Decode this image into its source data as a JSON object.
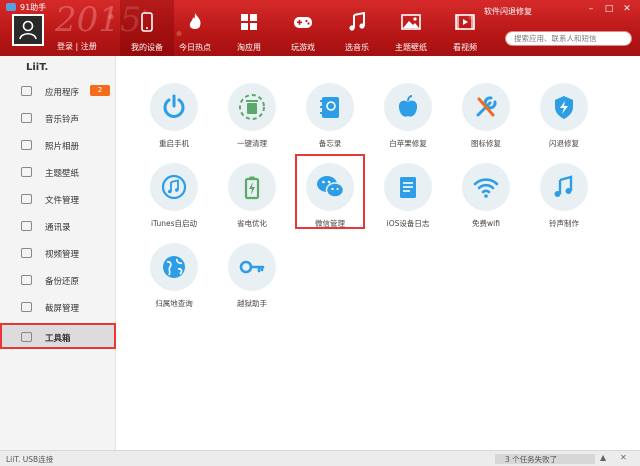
{
  "window": {
    "title": "91助手",
    "minimize": "–",
    "maximize": "□",
    "close": "✕"
  },
  "header": {
    "login_text": "登录 | 注册",
    "update_link": "软件闪退修复",
    "search_placeholder": "搜索应用、联系人和短信",
    "tabs": [
      {
        "label": "我的设备",
        "icon": "phone-icon",
        "active": true
      },
      {
        "label": "今日热点",
        "icon": "flame-icon",
        "active": false
      },
      {
        "label": "淘应用",
        "icon": "apps-icon",
        "active": false
      },
      {
        "label": "玩游戏",
        "icon": "gamepad-icon",
        "active": false
      },
      {
        "label": "选音乐",
        "icon": "music-icon",
        "active": false
      },
      {
        "label": "主题壁纸",
        "icon": "picture-icon",
        "active": false
      },
      {
        "label": "看视频",
        "icon": "film-icon",
        "active": false
      }
    ]
  },
  "sidebar": {
    "device_name": "LiiT.",
    "items": [
      {
        "label": "应用程序",
        "icon": "apps-icon",
        "badge": "2"
      },
      {
        "label": "音乐铃声",
        "icon": "music-note-icon"
      },
      {
        "label": "照片相册",
        "icon": "photo-icon"
      },
      {
        "label": "主题壁纸",
        "icon": "wallpaper-icon"
      },
      {
        "label": "文件管理",
        "icon": "folder-icon"
      },
      {
        "label": "通讯录",
        "icon": "contacts-icon"
      },
      {
        "label": "视频管理",
        "icon": "video-icon"
      },
      {
        "label": "备份还原",
        "icon": "backup-icon"
      },
      {
        "label": "截屏管理",
        "icon": "screenshot-icon"
      },
      {
        "label": "工具箱",
        "icon": "toolbox-icon",
        "selected": true
      }
    ]
  },
  "tools": [
    {
      "label": "重启手机",
      "icon": "power-icon"
    },
    {
      "label": "一键清理",
      "icon": "trash-icon"
    },
    {
      "label": "备忘录",
      "icon": "notebook-icon"
    },
    {
      "label": "白苹果修复",
      "icon": "apple-icon"
    },
    {
      "label": "图标修复",
      "icon": "wrench-icon"
    },
    {
      "label": "闪退修复",
      "icon": "shield-bolt-icon"
    },
    {
      "label": "iTunes自启动",
      "icon": "itunes-icon"
    },
    {
      "label": "省电优化",
      "icon": "battery-icon"
    },
    {
      "label": "微信管理",
      "icon": "wechat-icon",
      "highlighted": true
    },
    {
      "label": "iOS设备日志",
      "icon": "log-icon"
    },
    {
      "label": "免费wifi",
      "icon": "wifi-icon"
    },
    {
      "label": "铃声制作",
      "icon": "ringtone-icon"
    },
    {
      "label": "归属地查询",
      "icon": "globe-icon"
    },
    {
      "label": "越狱助手",
      "icon": "key-icon"
    }
  ],
  "statusbar": {
    "device": "LiiT.  USB连接",
    "tasks": "3 个任务失败了",
    "caret": "▲",
    "close": "✕"
  },
  "colors": {
    "header_red": "#c21d1d",
    "accent_blue": "#2d9de6",
    "highlight_red": "#e53935",
    "badge_orange": "#f46b1c"
  }
}
